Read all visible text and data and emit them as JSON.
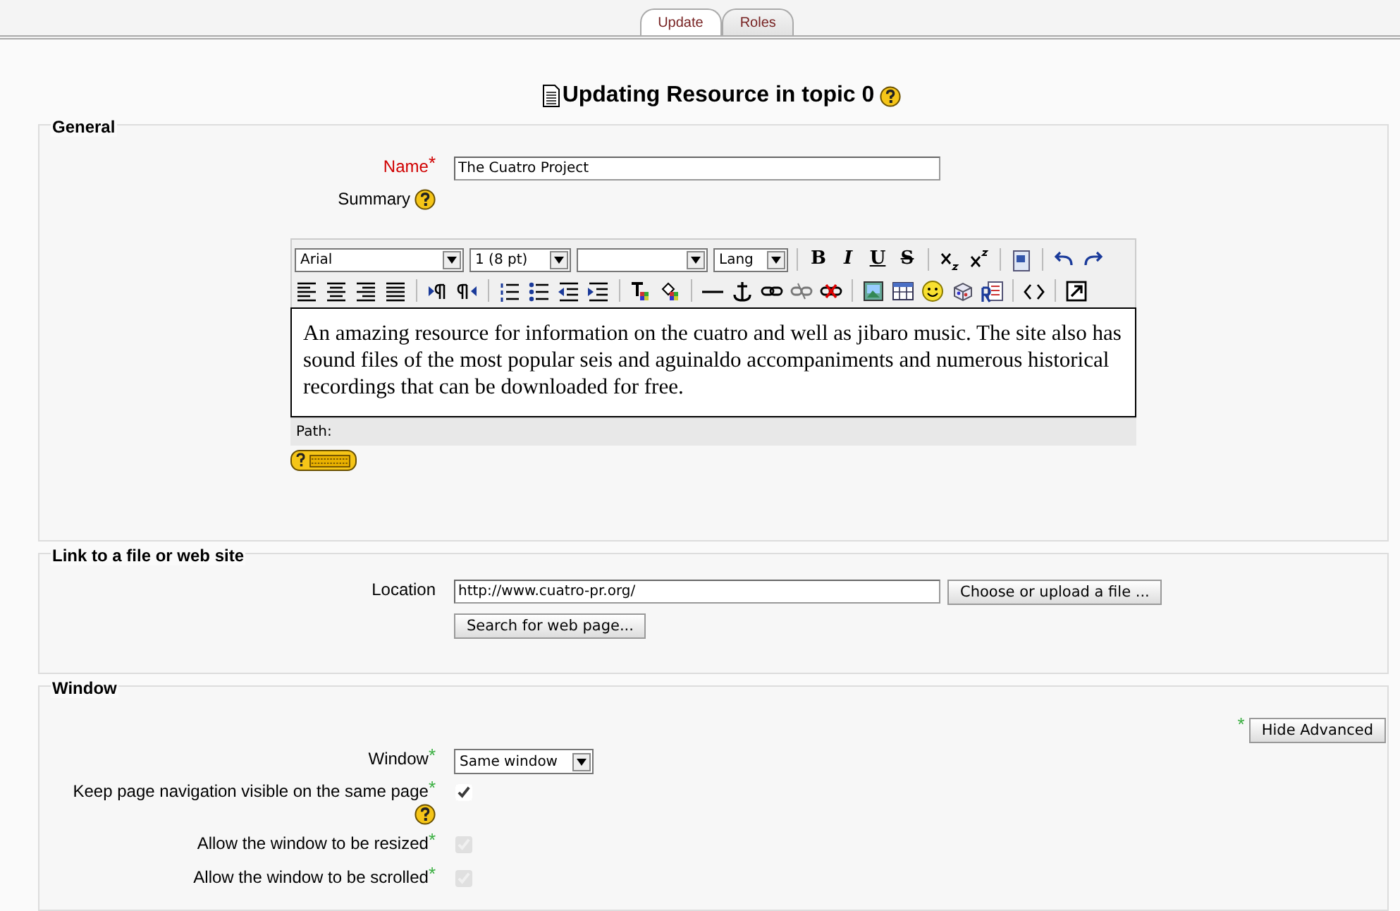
{
  "tabs": [
    {
      "label": "Update",
      "selected": true
    },
    {
      "label": "Roles",
      "selected": false
    }
  ],
  "heading": {
    "title": "Updating Resource in topic 0"
  },
  "general": {
    "legend": "General",
    "name": {
      "label": "Name",
      "required_mark": "*",
      "value": "The Cuatro Project"
    },
    "summary": {
      "label": "Summary"
    },
    "editor": {
      "font": "Arial",
      "size": "1 (8 pt)",
      "lang": "Lang",
      "format_buttons": [
        "B",
        "I",
        "U",
        "S"
      ],
      "content": "An amazing resource for information on the cuatro and well as jibaro music. The site also has sound files of the most popular seis and aguinaldo accompaniments and numerous historical recordings that can be downloaded for free.",
      "path_label": "Path:"
    }
  },
  "link": {
    "legend": "Link to a file or web site",
    "location": {
      "label": "Location",
      "value": "http://www.cuatro-pr.org/"
    },
    "choose_button": "Choose or upload a file ...",
    "search_button": "Search for web page..."
  },
  "window_section": {
    "legend": "Window",
    "advanced_mark": "*",
    "advanced_button": "Hide Advanced",
    "window": {
      "label": "Window",
      "advanced_mark": "*",
      "value": "Same window"
    },
    "options": [
      {
        "label": "Keep page navigation visible on the same page",
        "advanced_mark": "*",
        "checked": true,
        "disabled": false,
        "help": true
      },
      {
        "label": "Allow the window to be resized",
        "advanced_mark": "*",
        "checked": true,
        "disabled": true,
        "help": false
      },
      {
        "label": "Allow the window to be scrolled",
        "advanced_mark": "*",
        "checked": true,
        "disabled": true,
        "help": false
      }
    ]
  }
}
